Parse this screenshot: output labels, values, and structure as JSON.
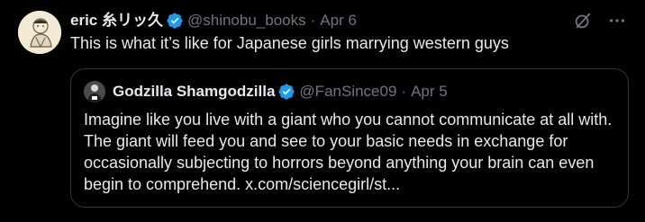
{
  "tweet": {
    "author_name": "eric 糸リッ久",
    "handle": "@shinobu_books",
    "separator": "·",
    "date": "Apr 6",
    "text": "This is what it’s like for Japanese girls marrying western guys"
  },
  "quoted": {
    "author_name": "Godzilla Shamgodzilla",
    "handle": "@FanSince09",
    "separator": "·",
    "date": "Apr 5",
    "text": "Imagine like you live with a giant who you cannot communicate at all with. The giant will feed you and see to your basic needs in exchange for occasionally subjecting to horrors beyond anything your brain can even begin to comprehend. x.com/sciencegirl/st..."
  },
  "icons": {
    "verified": "verified-badge-icon",
    "grok": "grok-slash-icon",
    "more": "more-horizontal-icon"
  },
  "colors": {
    "background": "#000000",
    "text": "#e7e9ea",
    "secondary": "#71767b",
    "verified": "#1d9bf0",
    "border": "#2f3336"
  }
}
